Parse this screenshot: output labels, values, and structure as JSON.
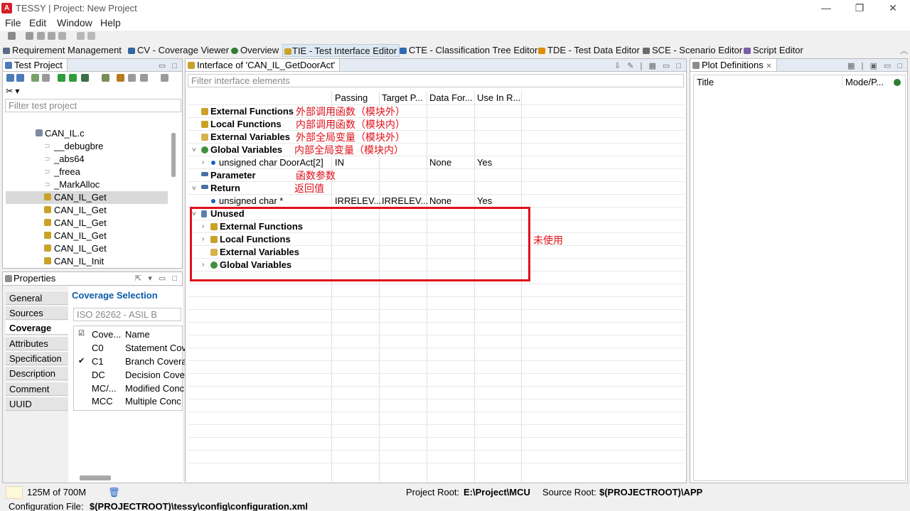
{
  "window": {
    "title": "TESSY | Project: New Project",
    "app_badge": "A",
    "controls": [
      "—",
      "❐",
      "✕"
    ]
  },
  "menu": [
    "File",
    "Edit",
    "Window",
    "Help"
  ],
  "perspectives": [
    {
      "label": "Requirement Management",
      "color": "#5a6a88"
    },
    {
      "label": "CV - Coverage Viewer",
      "color": "#3465a4"
    },
    {
      "label": "Overview",
      "color": "#2e7d32"
    },
    {
      "label": "TIE - Test Interface Editor",
      "color": "#c9a227",
      "active": true
    },
    {
      "label": "CTE - Classification Tree Editor",
      "color": "#2f6bb0"
    },
    {
      "label": "TDE - Test Data Editor",
      "color": "#d98e04"
    },
    {
      "label": "SCE - Scenario Editor",
      "color": "#6a6a6a"
    },
    {
      "label": "Script Editor",
      "color": "#7b5ea7"
    }
  ],
  "test_project": {
    "title": "Test Project",
    "filter_placeholder": "Filter test project",
    "file": "CAN_IL.c",
    "items": [
      "__debugbre",
      "_abs64",
      "_freea",
      "_MarkAlloc",
      "CAN_IL_Get",
      "CAN_IL_Get",
      "CAN_IL_Get",
      "CAN_IL_Get",
      "CAN_IL_Get",
      "CAN_IL_Init"
    ],
    "selected_index": 4
  },
  "properties": {
    "title": "Properties",
    "tabs": [
      "General",
      "Sources",
      "Coverage",
      "Attributes",
      "Specification",
      "Description",
      "Comment",
      "UUID"
    ],
    "active_tab": "Coverage",
    "coverage_selection_label": "Coverage Selection",
    "standard_value": "ISO 26262 - ASIL B",
    "table_headers": [
      "☑",
      "Cove...",
      "Name"
    ],
    "rows": [
      {
        "checked": "",
        "code": "C0",
        "name": "Statement Cov"
      },
      {
        "checked": "✔",
        "code": "C1",
        "name": "Branch Covera"
      },
      {
        "checked": "",
        "code": "DC",
        "name": "Decision Cove"
      },
      {
        "checked": "",
        "code": "MC/...",
        "name": "Modified Conc"
      },
      {
        "checked": "",
        "code": "MCC",
        "name": "Multiple Conc"
      }
    ]
  },
  "interface": {
    "title": "Interface of 'CAN_IL_GetDoorAct'",
    "filter_placeholder": "Filter interface elements",
    "columns": [
      "Passing",
      "Target P...",
      "Data For...",
      "Use In R..."
    ],
    "rows": [
      {
        "label": "External Functions",
        "note": "外部调用函数（模块外）"
      },
      {
        "label": "Local Functions",
        "note": "内部调用函数（模块内）"
      },
      {
        "label": "External Variables",
        "note": "外部全局变量（模块外）"
      },
      {
        "label": "Global Variables",
        "note": "内部全局变量（模块内）"
      },
      {
        "label": "unsigned char DoorAct[2]",
        "passing": "IN",
        "target": "",
        "data_format": "None",
        "use_in_report": "Yes"
      },
      {
        "label": "Parameter",
        "note": "函数参数"
      },
      {
        "label": "Return",
        "note": "返回值"
      },
      {
        "label": "unsigned char *",
        "passing": "IRRELEV...",
        "target": "IRRELEV...",
        "data_format": "None",
        "use_in_report": "Yes"
      },
      {
        "label": "Unused"
      },
      {
        "label": "External Functions"
      },
      {
        "label": "Local Functions"
      },
      {
        "label": "External Variables"
      },
      {
        "label": "Global Variables"
      }
    ],
    "unused_note": "未使用"
  },
  "plot_definitions": {
    "title": "Plot Definitions",
    "columns": [
      "Title",
      "Mode/P..."
    ]
  },
  "status": {
    "memory": "125M of 700M",
    "project_root_label": "Project Root:",
    "project_root": "E:\\Project\\MCU",
    "source_root_label": "Source Root:",
    "source_root": "$(PROJECTROOT)\\APP",
    "config_label": "Configuration File:",
    "config_file": "$(PROJECTROOT)\\tessy\\config\\configuration.xml"
  },
  "colors": {
    "annotation": "#e0101a",
    "highlight_box": "#e0101a",
    "selection": "#d9d9d9",
    "accent": "#0a5ca8"
  }
}
